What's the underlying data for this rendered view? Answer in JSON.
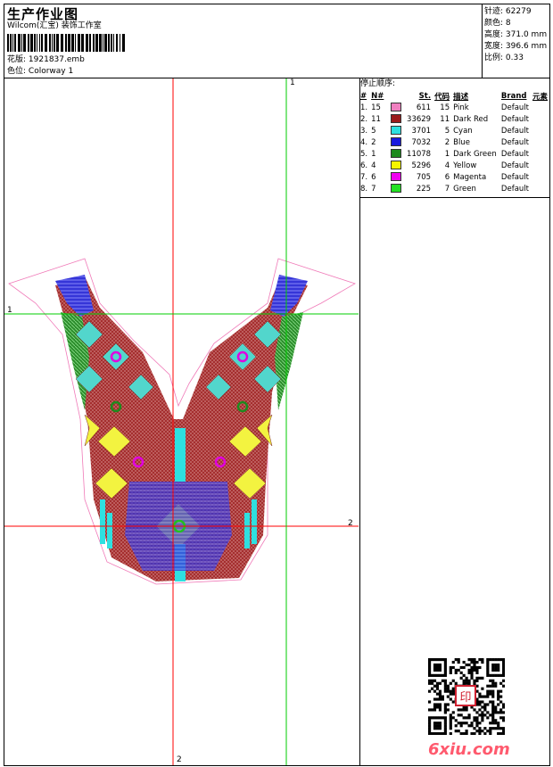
{
  "header": {
    "title": "生产作业图",
    "company": "Wilcom(汇宝) 装饰工作室",
    "design_label": "花版:",
    "design_value": "1921837.emb",
    "colorway_label": "色位:",
    "colorway_value": "Colorway 1"
  },
  "summary": [
    {
      "label": "针迹:",
      "value": "62279"
    },
    {
      "label": "颜色:",
      "value": "8"
    },
    {
      "label": "高度:",
      "value": "371.0 mm"
    },
    {
      "label": "宽度:",
      "value": "396.6 mm"
    },
    {
      "label": "比例:",
      "value": "0.33"
    }
  ],
  "stop_sequence": {
    "title": "停止顺序:",
    "columns": [
      "#",
      "N#",
      "St.",
      "代码",
      "描述",
      "Brand",
      "元素"
    ],
    "rows": [
      {
        "idx": "1.",
        "n": "15",
        "color": "#f080c0",
        "st": "611",
        "code": "15",
        "desc": "Pink",
        "brand": "Default"
      },
      {
        "idx": "2.",
        "n": "11",
        "color": "#9b1c1c",
        "st": "33629",
        "code": "11",
        "desc": "Dark Red",
        "brand": "Default"
      },
      {
        "idx": "3.",
        "n": "5",
        "color": "#2ee0e0",
        "st": "3701",
        "code": "5",
        "desc": "Cyan",
        "brand": "Default"
      },
      {
        "idx": "4.",
        "n": "2",
        "color": "#1a1adf",
        "st": "7032",
        "code": "2",
        "desc": "Blue",
        "brand": "Default"
      },
      {
        "idx": "5.",
        "n": "1",
        "color": "#1e8a1e",
        "st": "11078",
        "code": "1",
        "desc": "Dark Green",
        "brand": "Default"
      },
      {
        "idx": "6.",
        "n": "4",
        "color": "#f5f500",
        "st": "5296",
        "code": "4",
        "desc": "Yellow",
        "brand": "Default"
      },
      {
        "idx": "7.",
        "n": "6",
        "color": "#f000f0",
        "st": "705",
        "code": "6",
        "desc": "Magenta",
        "brand": "Default"
      },
      {
        "idx": "8.",
        "n": "7",
        "color": "#22e022",
        "st": "225",
        "code": "7",
        "desc": "Green",
        "brand": "Default"
      }
    ]
  },
  "guides": {
    "line1_label": "1",
    "line2_label": "2",
    "red_color": "#ff0000",
    "green_color": "#00cc00"
  },
  "watermark": "6xiu.com",
  "stamp_text": "印"
}
